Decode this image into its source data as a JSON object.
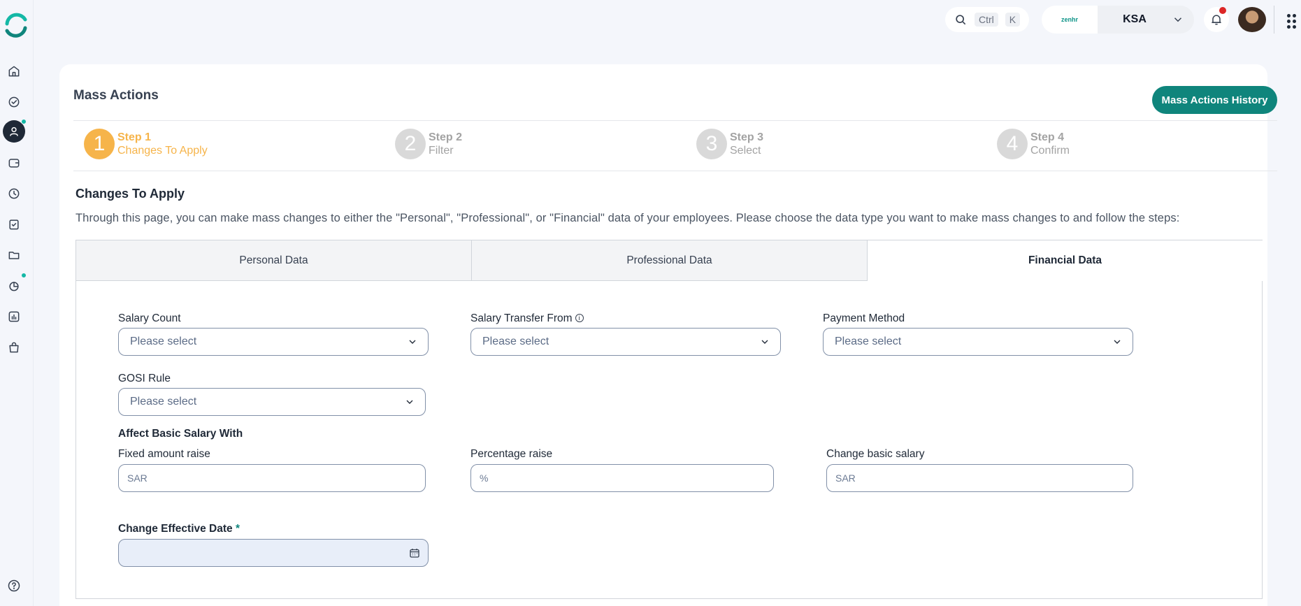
{
  "topbar": {
    "search_shortcut_key1": "Ctrl",
    "search_shortcut_key2": "K",
    "company_logo_text": "zenhr",
    "company_name": "KSA"
  },
  "page": {
    "title": "Mass Actions",
    "history_button": "Mass Actions History"
  },
  "steps": [
    {
      "number": "1",
      "title": "Step 1",
      "subtitle": "Changes To Apply",
      "active": true
    },
    {
      "number": "2",
      "title": "Step 2",
      "subtitle": "Filter",
      "active": false
    },
    {
      "number": "3",
      "title": "Step 3",
      "subtitle": "Select",
      "active": false
    },
    {
      "number": "4",
      "title": "Step 4",
      "subtitle": "Confirm",
      "active": false
    }
  ],
  "section": {
    "title": "Changes To Apply",
    "description": "Through this page, you can make mass changes to either the \"Personal\", \"Professional\", or \"Financial\" data of your employees. Please choose the data type you want to make mass changes to and follow the steps:"
  },
  "tabs": [
    {
      "label": "Personal Data",
      "selected": false
    },
    {
      "label": "Professional Data",
      "selected": false
    },
    {
      "label": "Financial Data",
      "selected": true
    }
  ],
  "form": {
    "salary_count": {
      "label": "Salary Count",
      "placeholder": "Please select"
    },
    "salary_transfer_from": {
      "label": "Salary Transfer From",
      "placeholder": "Please select"
    },
    "payment_method": {
      "label": "Payment Method",
      "placeholder": "Please select"
    },
    "gosi_rule": {
      "label": "GOSI Rule",
      "placeholder": "Please select"
    },
    "affect_basic_salary_heading": "Affect Basic Salary With",
    "fixed_amount_raise": {
      "label": "Fixed amount raise",
      "placeholder": "SAR"
    },
    "percentage_raise": {
      "label": "Percentage raise",
      "placeholder": "%"
    },
    "change_basic_salary": {
      "label": "Change basic salary",
      "placeholder": "SAR"
    },
    "change_effective_date": {
      "label": "Change Effective Date",
      "required_mark": "*"
    }
  },
  "colors": {
    "primary": "#0f857c",
    "step_active": "#f6b44a",
    "step_inactive": "#d9d9d9",
    "notification": "#dc2626",
    "status_dot": "#14b8a6"
  }
}
